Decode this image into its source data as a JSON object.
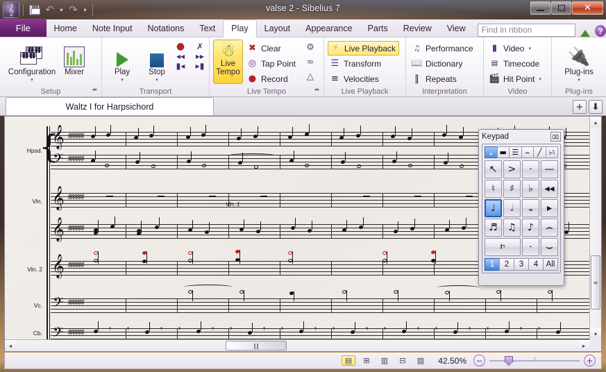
{
  "window": {
    "title": "valse 2 - Sibelius 7",
    "logo_glyph": "𝄞",
    "quick_access": [
      {
        "name": "save",
        "label": "Save"
      },
      {
        "name": "undo",
        "label": "Undo"
      },
      {
        "name": "redo",
        "label": "Redo"
      }
    ],
    "buttons": {
      "minimize": "",
      "maximize": "",
      "close": "✕"
    }
  },
  "ribbon": {
    "file_tab": "File",
    "tabs": [
      {
        "label": "Home",
        "active": false
      },
      {
        "label": "Note Input",
        "active": false
      },
      {
        "label": "Notations",
        "active": false
      },
      {
        "label": "Text",
        "active": false
      },
      {
        "label": "Play",
        "active": true
      },
      {
        "label": "Layout",
        "active": false
      },
      {
        "label": "Appearance",
        "active": false
      },
      {
        "label": "Parts",
        "active": false
      },
      {
        "label": "Review",
        "active": false
      },
      {
        "label": "View",
        "active": false
      }
    ],
    "find_placeholder": "Find in ribbon",
    "collapse_label": "▲",
    "help_label": "?",
    "groups": {
      "setup": {
        "label": "Setup",
        "configuration": {
          "label": "Configuration",
          "dropdown": "▾"
        },
        "mixer": {
          "label": "Mixer"
        },
        "dialog_launcher": "⬌"
      },
      "transport": {
        "label": "Transport",
        "play": {
          "label": "Play",
          "dropdown": "▾"
        },
        "stop": {
          "label": "Stop",
          "dropdown": "▾"
        },
        "record": "●",
        "move_playback": "✗",
        "rewind": "◂◂",
        "fast_forward": "▸▸",
        "go_to_start": "▮◂",
        "go_to_end": "▸▮"
      },
      "live_tempo": {
        "label": "Live Tempo",
        "main_button": "Live\nTempo",
        "main_line1": "Live",
        "main_line2": "Tempo",
        "items": [
          {
            "label": "Clear",
            "icon": "clear-icon"
          },
          {
            "label": "Tap Point",
            "icon": "tap-point-icon"
          },
          {
            "label": "Record",
            "icon": "record-icon"
          }
        ],
        "extras": [
          "live-tempo-options-icon",
          "loop-icon",
          "tempo-graph-icon"
        ],
        "dialog_launcher": "⬌"
      },
      "live_playback": {
        "label": "Live Playback",
        "items": [
          {
            "label": "Live Playback",
            "icon": "lightning-icon",
            "active": true
          },
          {
            "label": "Transform",
            "icon": "transform-icon",
            "active": false
          },
          {
            "label": "Velocities",
            "icon": "velocities-icon",
            "active": false
          }
        ]
      },
      "interpretation": {
        "label": "Interpretation",
        "items": [
          {
            "label": "Performance",
            "icon": "performance-icon"
          },
          {
            "label": "Dictionary",
            "icon": "dictionary-icon"
          },
          {
            "label": "Repeats",
            "icon": "repeats-icon"
          }
        ]
      },
      "video": {
        "label": "Video",
        "items": [
          {
            "label": "Video",
            "icon": "video-icon",
            "dropdown": "▾"
          },
          {
            "label": "Timecode",
            "icon": "timecode-icon",
            "dropdown": ""
          },
          {
            "label": "Hit Point",
            "icon": "hit-point-icon",
            "dropdown": "▾"
          }
        ]
      },
      "plugins": {
        "label": "Plug-ins",
        "button_label": "Plug-ins",
        "dropdown": "▾"
      }
    }
  },
  "doctabs": {
    "tabs": [
      {
        "label": "Waltz I for Harpsichord",
        "active": true
      }
    ],
    "new_tab": "+",
    "tab_list": "⬇"
  },
  "score": {
    "instruments": [
      "Hpsd.",
      "Vln.",
      "Vln. 2",
      "Vc.",
      "Cb."
    ],
    "text_markings": [
      {
        "text": "Vln. 1"
      }
    ],
    "clefs": {
      "treble": "𝄞",
      "bass": "𝄢"
    },
    "key_signature_accidental": "♯",
    "key_signature_count": 6
  },
  "keypad": {
    "title": "Keypad",
    "close_label": "⌧",
    "layout_tabs": [
      {
        "name": "common-notes",
        "glyph": "𝅝",
        "selected": true
      },
      {
        "name": "more-notes",
        "glyph": "▬",
        "selected": false
      },
      {
        "name": "beams-tremolos",
        "glyph": "☰",
        "selected": false
      },
      {
        "name": "articulations",
        "glyph": "⌢",
        "selected": false
      },
      {
        "name": "jazz-articulations",
        "glyph": "╱",
        "selected": false
      },
      {
        "name": "accidentals",
        "glyph": "♭♮",
        "selected": false
      }
    ],
    "keys": [
      {
        "name": "voice-cursor",
        "glyph": "↖",
        "selected": false
      },
      {
        "name": "accent",
        "glyph": ">",
        "selected": false
      },
      {
        "name": "staccato",
        "glyph": "·",
        "selected": false
      },
      {
        "name": "tenuto",
        "glyph": "—",
        "selected": false
      },
      {
        "name": "natural",
        "glyph": "♮",
        "selected": false
      },
      {
        "name": "sharp",
        "glyph": "♯",
        "selected": false
      },
      {
        "name": "flat",
        "glyph": "♭",
        "selected": false
      },
      {
        "name": "rewind",
        "glyph": "◂◂",
        "selected": false
      },
      {
        "name": "quarter-note",
        "glyph": "♩",
        "selected": true
      },
      {
        "name": "half-note",
        "glyph": "𝅗𝅥",
        "selected": false
      },
      {
        "name": "whole-note",
        "glyph": "𝅝",
        "selected": false
      },
      {
        "name": "play",
        "glyph": "▸",
        "selected": false
      },
      {
        "name": "sixteenth-note",
        "glyph": "♬",
        "selected": false
      },
      {
        "name": "eighth-note-beamed",
        "glyph": "♫",
        "selected": false
      },
      {
        "name": "eighth-note",
        "glyph": "♪",
        "selected": false
      },
      {
        "name": "tie",
        "glyph": "⌢",
        "selected": false
      },
      {
        "name": "rest",
        "glyph": "𝄽𝄾",
        "selected": false
      },
      {
        "name": "blank-key",
        "glyph": "",
        "selected": false
      },
      {
        "name": "dot",
        "glyph": "·",
        "selected": false
      },
      {
        "name": "slur",
        "glyph": "",
        "selected": false
      }
    ],
    "number_tabs": [
      {
        "label": "1",
        "selected": true
      },
      {
        "label": "2",
        "selected": false
      },
      {
        "label": "3",
        "selected": false
      },
      {
        "label": "4",
        "selected": false
      },
      {
        "label": "All",
        "selected": false
      }
    ]
  },
  "statusbar": {
    "view_icons": [
      {
        "name": "panorama-view",
        "glyph": "▤",
        "selected": true
      },
      {
        "name": "page-view-spreads",
        "glyph": "⊞",
        "selected": false
      },
      {
        "name": "page-view-horizontal",
        "glyph": "▥",
        "selected": false
      },
      {
        "name": "page-view-vertical",
        "glyph": "⊟",
        "selected": false
      },
      {
        "name": "full-screen-view",
        "glyph": "▨",
        "selected": false
      }
    ],
    "zoom_value": "42.50%",
    "zoom_out": "−",
    "zoom_in": "+"
  },
  "scrollbars": {
    "up": "▴",
    "down": "▾",
    "left": "◂",
    "right": "▸",
    "v_grip": "≡",
    "h_grip": "‖‖"
  },
  "colors": {
    "accent_purple": "#6f2575",
    "highlight_yellow": "#ffe469",
    "keypad_blue": "#4f8ee0",
    "out_of_range_red": "#c02020",
    "play_green": "#3f9a30"
  }
}
